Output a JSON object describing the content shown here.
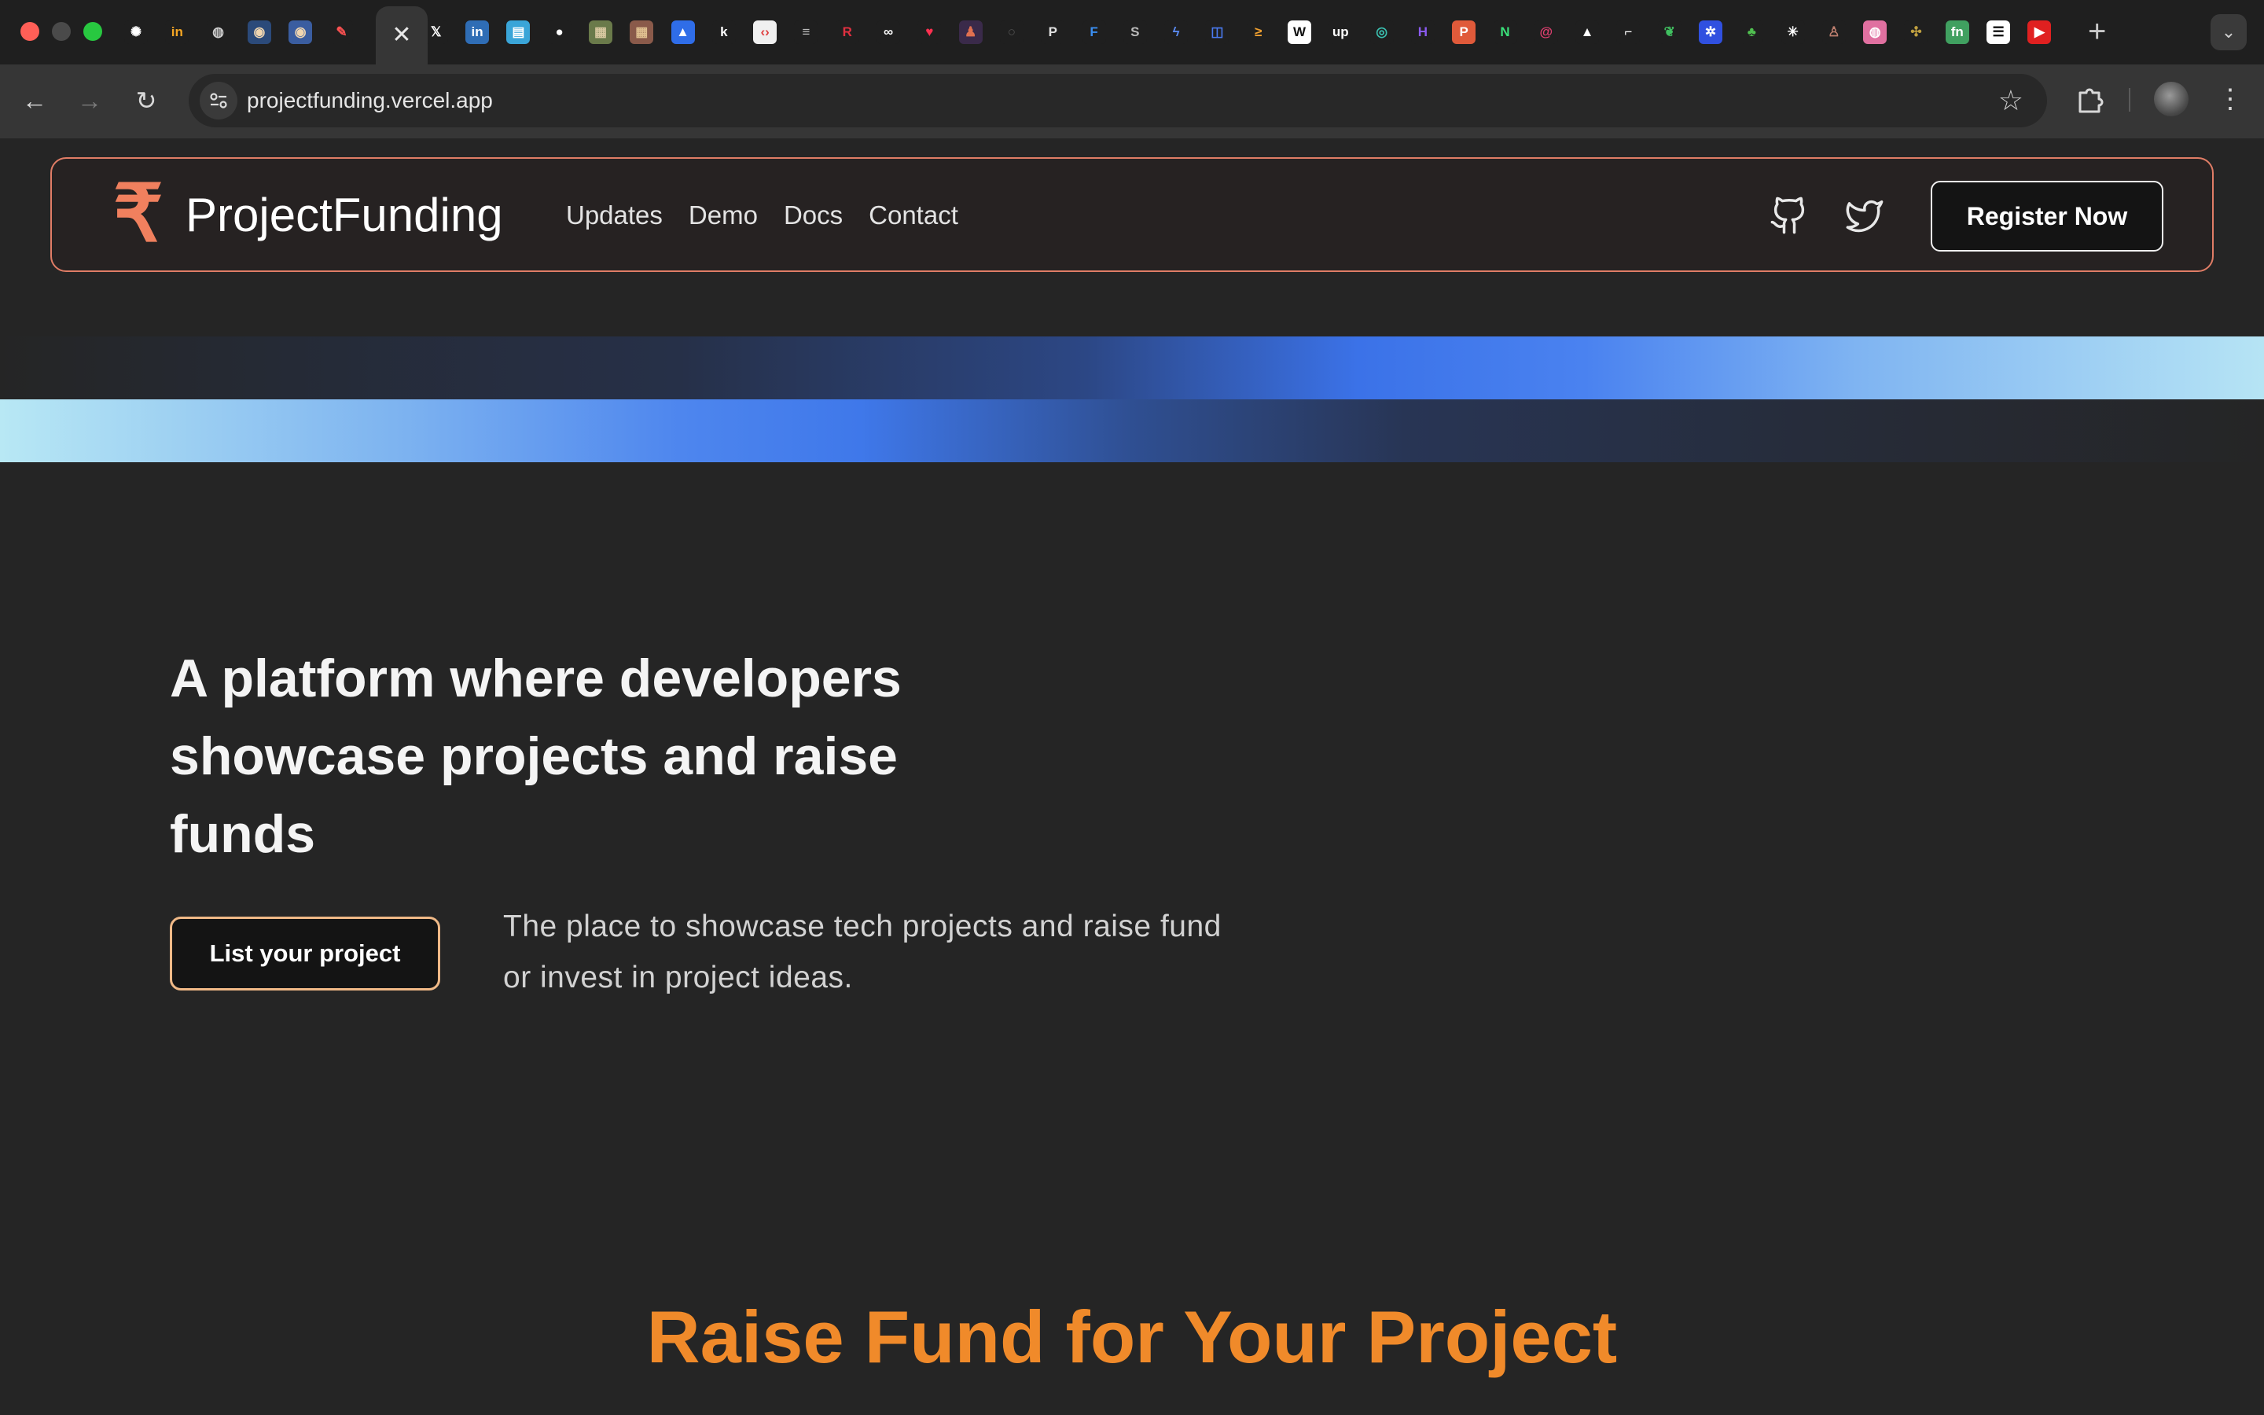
{
  "browser": {
    "tabs": [
      {
        "icon": "chatgpt-icon",
        "glyph": "✺",
        "bg": "#1f1f1f",
        "fg": "#ffffff"
      },
      {
        "icon": "invision-icon",
        "glyph": "in",
        "bg": "#1f1f1f",
        "fg": "#f5a623"
      },
      {
        "icon": "globe-icon",
        "glyph": "◍",
        "bg": "#1f1f1f",
        "fg": "#cfcfcf"
      },
      {
        "icon": "profile-photo-icon",
        "glyph": "◉",
        "bg": "#2b4a7a",
        "fg": "#f0d6b0"
      },
      {
        "icon": "profile-photo-icon",
        "glyph": "◉",
        "bg": "#3a5da0",
        "fg": "#f0d6b0"
      },
      {
        "icon": "edit-note-icon",
        "glyph": "✎",
        "bg": "#1f1f1f",
        "fg": "#ff5252"
      },
      {
        "icon": "x-icon",
        "glyph": "𝕏",
        "bg": "#1f1f1f",
        "fg": "#ffffff"
      },
      {
        "icon": "linkedin-icon",
        "glyph": "in",
        "bg": "#2f6db5",
        "fg": "#ffffff"
      },
      {
        "icon": "document-icon",
        "glyph": "▤",
        "bg": "#3aa5d8",
        "fg": "#ffffff"
      },
      {
        "icon": "github-icon",
        "glyph": "●",
        "bg": "#1f1f1f",
        "fg": "#ffffff"
      },
      {
        "icon": "photo-icon",
        "glyph": "▦",
        "bg": "#6a7a4a",
        "fg": "#d8c8a0"
      },
      {
        "icon": "photo-icon",
        "glyph": "▦",
        "bg": "#8a5a4a",
        "fg": "#e0c090"
      },
      {
        "icon": "notch-icon",
        "glyph": "▲",
        "bg": "#2f6de8",
        "fg": "#ffffff"
      },
      {
        "icon": "k-icon",
        "glyph": "k",
        "bg": "#1f1f1f",
        "fg": "#ffffff"
      },
      {
        "icon": "code-icon",
        "glyph": "‹›",
        "bg": "#f0f0f0",
        "fg": "#e04040"
      },
      {
        "icon": "lines-icon",
        "glyph": "≡",
        "bg": "#1f1f1f",
        "fg": "#bbbbbb"
      },
      {
        "icon": "r-icon",
        "glyph": "R",
        "bg": "#1f1f1f",
        "fg": "#e03040"
      },
      {
        "icon": "link-icon",
        "glyph": "∞",
        "bg": "#1f1f1f",
        "fg": "#ffffff"
      },
      {
        "icon": "heart-icon",
        "glyph": "♥",
        "bg": "#1f1f1f",
        "fg": "#ff3050"
      },
      {
        "icon": "character-icon",
        "glyph": "♟",
        "bg": "#3a2a4a",
        "fg": "#e07050"
      },
      {
        "icon": "circle-icon",
        "glyph": "○",
        "bg": "#1f1f1f",
        "fg": "#555555"
      },
      {
        "icon": "p-icon",
        "glyph": "P",
        "bg": "#1f1f1f",
        "fg": "#e0e0e0"
      },
      {
        "icon": "f-icon",
        "glyph": "F",
        "bg": "#1f1f1f",
        "fg": "#3a8ef0"
      },
      {
        "icon": "s-icon",
        "glyph": "S",
        "bg": "#1f1f1f",
        "fg": "#bbbbbb"
      },
      {
        "icon": "lightning-icon",
        "glyph": "ϟ",
        "bg": "#1f1f1f",
        "fg": "#5a8af0"
      },
      {
        "icon": "chat-icon",
        "glyph": "◫",
        "bg": "#1f1f1f",
        "fg": "#4a7af0"
      },
      {
        "icon": "arrow-icon",
        "glyph": "≥",
        "bg": "#1f1f1f",
        "fg": "#f0a030"
      },
      {
        "icon": "w-icon",
        "glyph": "W",
        "bg": "#ffffff",
        "fg": "#111111"
      },
      {
        "icon": "upwork-icon",
        "glyph": "up",
        "bg": "#1f1f1f",
        "fg": "#ffffff"
      },
      {
        "icon": "leaf-icon",
        "glyph": "◎",
        "bg": "#1f1f1f",
        "fg": "#3ac0b0"
      },
      {
        "icon": "h-icon",
        "glyph": "H",
        "bg": "#1f1f1f",
        "fg": "#8a5af0"
      },
      {
        "icon": "producthunt-icon",
        "glyph": "P",
        "bg": "#e05a3a",
        "fg": "#ffffff"
      },
      {
        "icon": "n-icon",
        "glyph": "N",
        "bg": "#1f1f1f",
        "fg": "#3ae07a"
      },
      {
        "icon": "swirl-icon",
        "glyph": "@",
        "bg": "#1f1f1f",
        "fg": "#e04070"
      },
      {
        "icon": "triangle-icon",
        "glyph": "▲",
        "bg": "#1f1f1f",
        "fg": "#ffffff"
      },
      {
        "icon": "pipe-icon",
        "glyph": "⌐",
        "bg": "#1f1f1f",
        "fg": "#ffffff"
      },
      {
        "icon": "mongodb-leaf-icon",
        "glyph": "❦",
        "bg": "#1f1f1f",
        "fg": "#40c060"
      },
      {
        "icon": "puzzle-icon",
        "glyph": "✲",
        "bg": "#3050e0",
        "fg": "#ffffff"
      },
      {
        "icon": "mushroom-icon",
        "glyph": "♣",
        "bg": "#1f1f1f",
        "fg": "#50c050"
      },
      {
        "icon": "asterisk-icon",
        "glyph": "✳",
        "bg": "#1f1f1f",
        "fg": "#ffffff"
      },
      {
        "icon": "people-icon",
        "glyph": "♙",
        "bg": "#1f1f1f",
        "fg": "#c08070"
      },
      {
        "icon": "dribbble-icon",
        "glyph": "◍",
        "bg": "#e070a0",
        "fg": "#ffffff"
      },
      {
        "icon": "pattern-icon",
        "glyph": "✣",
        "bg": "#1f1f1f",
        "fg": "#c0a040"
      },
      {
        "icon": "fn-icon",
        "glyph": "fn",
        "bg": "#40a060",
        "fg": "#ffffff"
      },
      {
        "icon": "bars-icon",
        "glyph": "☰",
        "bg": "#ffffff",
        "fg": "#111111"
      },
      {
        "icon": "youtube-icon",
        "glyph": "▶",
        "bg": "#e02020",
        "fg": "#ffffff"
      }
    ],
    "active_tab_close": "✕",
    "new_tab": "+",
    "tab_menu": "⌄",
    "url": "projectfunding.vercel.app"
  },
  "site": {
    "logo_glyph": "₹",
    "brand": "ProjectFunding",
    "nav": [
      "Updates",
      "Demo",
      "Docs",
      "Contact"
    ],
    "register_label": "Register Now",
    "accent": "#f0805e"
  },
  "hero": {
    "headline": "A platform where developers showcase projects and raise funds",
    "cta_label": "List your project",
    "subtext": "The place to showcase tech projects and raise fund or invest in project ideas."
  },
  "section": {
    "title": "Raise Fund for Your Project"
  }
}
